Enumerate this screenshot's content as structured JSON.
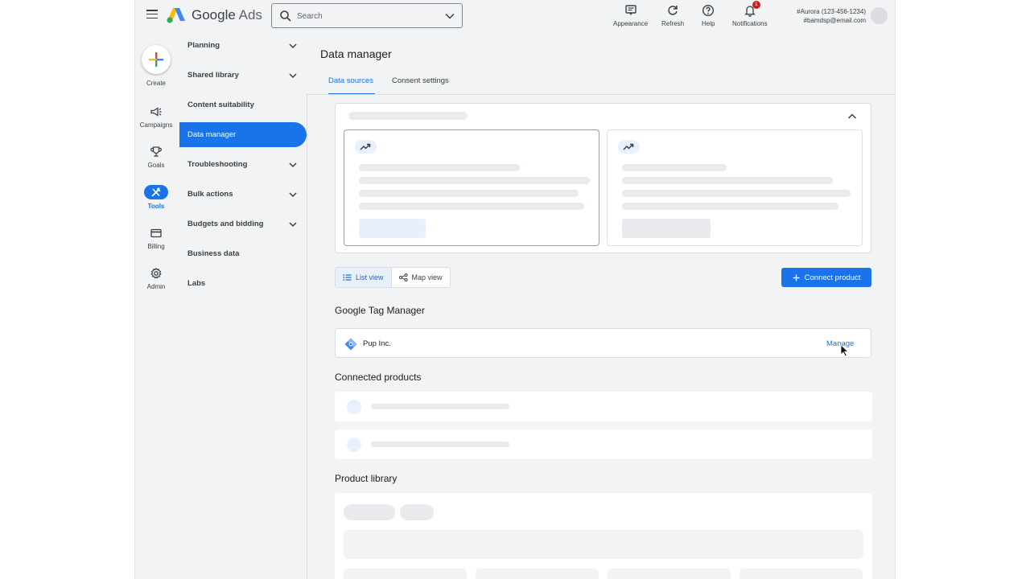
{
  "topbar": {
    "brand_google": "Google",
    "brand_ads": "Ads",
    "search_placeholder": "Search",
    "actions": [
      {
        "label": "Appearance",
        "icon": "appearance-icon"
      },
      {
        "label": "Refresh",
        "icon": "refresh-icon"
      },
      {
        "label": "Help",
        "icon": "help-icon"
      },
      {
        "label": "Notifications",
        "icon": "bell-icon",
        "badge": "1"
      }
    ],
    "account_line1": "#Aurora (123-456-1234)",
    "account_line2": "#bamdsp@email.com"
  },
  "rail": {
    "create": "Create",
    "items": [
      {
        "label": "Campaigns",
        "icon": "megaphone-icon"
      },
      {
        "label": "Goals",
        "icon": "trophy-icon"
      },
      {
        "label": "Tools",
        "icon": "tools-icon",
        "active": true
      },
      {
        "label": "Billing",
        "icon": "credit-card-icon"
      },
      {
        "label": "Admin",
        "icon": "gear-icon"
      }
    ]
  },
  "nav": {
    "items": [
      {
        "label": "Planning",
        "expandable": true
      },
      {
        "label": "Shared library",
        "expandable": true
      },
      {
        "label": "Content suitability",
        "expandable": false
      },
      {
        "label": "Data manager",
        "expandable": false,
        "active": true
      },
      {
        "label": "Troubleshooting",
        "expandable": true
      },
      {
        "label": "Bulk actions",
        "expandable": true
      },
      {
        "label": "Budgets and bidding",
        "expandable": true
      },
      {
        "label": "Business data",
        "expandable": false
      },
      {
        "label": "Labs",
        "expandable": false
      }
    ]
  },
  "page": {
    "title": "Data manager",
    "tabs": [
      {
        "label": "Data sources",
        "active": true
      },
      {
        "label": "Consent settings",
        "active": false
      }
    ]
  },
  "toolbar": {
    "list_view": "List view",
    "map_view": "Map view",
    "connect_product": "Connect product"
  },
  "sections": {
    "gtm_heading": "Google Tag Manager",
    "gtm_item_name": "Pup Inc.",
    "gtm_item_action": "Manage",
    "connected_heading": "Connected products",
    "library_heading": "Product library"
  },
  "colors": {
    "accent": "#1a73e8",
    "background": "#f1f3f4",
    "skeleton": "#e8eaed",
    "badge": "#c5221f"
  }
}
